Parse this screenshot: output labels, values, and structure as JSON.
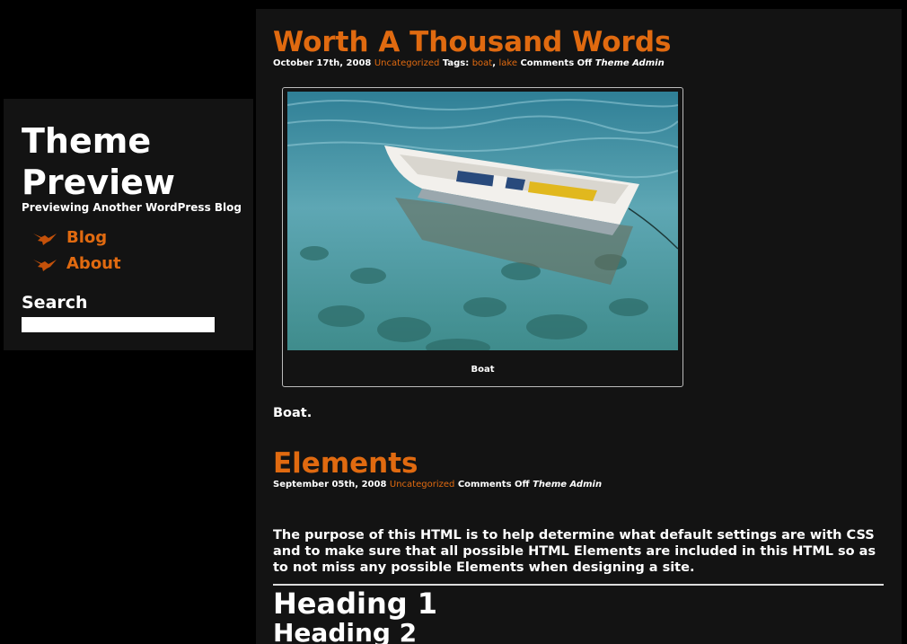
{
  "site": {
    "title": "Theme Preview",
    "description": "Previewing Another WordPress Blog"
  },
  "nav": {
    "items": [
      {
        "label": "Blog",
        "icon": "bird-icon"
      },
      {
        "label": "About",
        "icon": "bird-icon"
      }
    ]
  },
  "search": {
    "title": "Search",
    "value": ""
  },
  "posts": [
    {
      "title": "Worth A Thousand Words",
      "date": "October 17th, 2008",
      "category": "Uncategorized",
      "tags_label": "Tags:",
      "tags": [
        "boat",
        "lake"
      ],
      "comments": "Comments Off",
      "author": "Theme Admin",
      "caption": "Boat",
      "body": "Boat."
    },
    {
      "title": "Elements",
      "date": "September 05th, 2008",
      "category": "Uncategorized",
      "comments": "Comments Off",
      "author": "Theme Admin",
      "body": "The purpose of this HTML is to help determine what default settings are with CSS and to make sure that all possible HTML Elements are included in this HTML so as to not miss any possible Elements when designing a site.",
      "heading1": "Heading 1",
      "heading2": "Heading 2"
    }
  ],
  "colors": {
    "accent": "#e06a10",
    "background": "#000000",
    "panel": "#131313"
  }
}
